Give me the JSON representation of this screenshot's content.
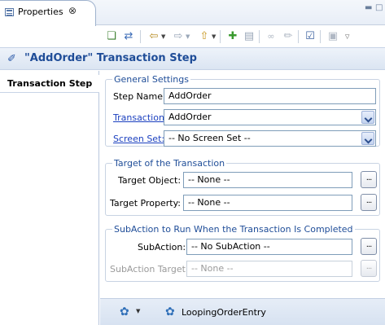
{
  "tab": {
    "label": "Properties",
    "close": "⊗"
  },
  "header": {
    "title": "\"AddOrder\" Transaction Step"
  },
  "nav": {
    "items": [
      {
        "label": "Transaction Step"
      }
    ]
  },
  "general": {
    "title": "General Settings",
    "step_name": {
      "label": "Step Name:",
      "value": "AddOrder"
    },
    "transaction": {
      "label": "Transaction:",
      "value": "AddOrder"
    },
    "screen_set": {
      "label": "Screen Set:",
      "value": "-- No Screen Set --"
    }
  },
  "target": {
    "title": "Target of the Transaction",
    "object": {
      "label": "Target Object:",
      "value": "-- None --"
    },
    "property": {
      "label": "Target Property:",
      "value": "-- None --"
    }
  },
  "subaction": {
    "title": "SubAction to Run When the Transaction Is Completed",
    "subaction": {
      "label": "SubAction:",
      "value": "-- No SubAction --"
    },
    "target": {
      "label": "SubAction Target:",
      "value": "-- None --"
    }
  },
  "browse_label": "...",
  "footer": {
    "label": "LoopingOrderEntry"
  }
}
